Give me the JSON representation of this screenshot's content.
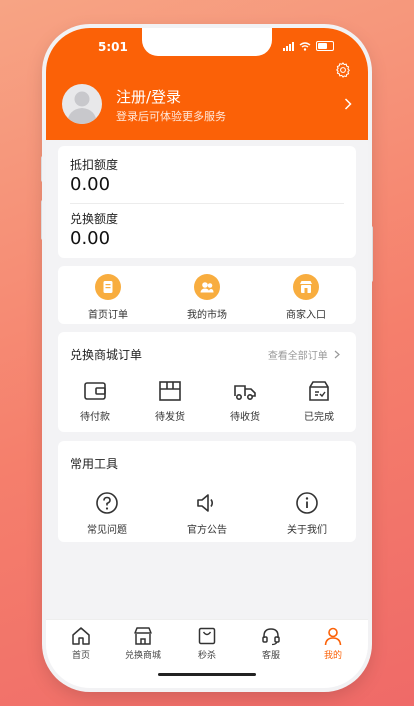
{
  "status_bar": {
    "time": "5:01"
  },
  "header": {
    "login_title": "注册/登录",
    "login_subtitle": "登录后可体验更多服务",
    "accent": "#fb6107"
  },
  "balances": {
    "deduct_label": "抵扣额度",
    "deduct_value": "0.00",
    "exchange_label": "兑换额度",
    "exchange_value": "0.00"
  },
  "quick_links": [
    {
      "label": "首页订单",
      "icon": "document-icon"
    },
    {
      "label": "我的市场",
      "icon": "users-icon"
    },
    {
      "label": "商家入口",
      "icon": "shop-icon"
    }
  ],
  "orders": {
    "title": "兑换商城订单",
    "view_all": "查看全部订单",
    "items": [
      {
        "label": "待付款",
        "icon": "wallet-icon"
      },
      {
        "label": "待发货",
        "icon": "box-icon"
      },
      {
        "label": "待收货",
        "icon": "truck-icon"
      },
      {
        "label": "已完成",
        "icon": "completed-box-icon"
      }
    ]
  },
  "tools": {
    "title": "常用工具",
    "items": [
      {
        "label": "常见问题",
        "icon": "question-icon"
      },
      {
        "label": "官方公告",
        "icon": "speaker-icon"
      },
      {
        "label": "关于我们",
        "icon": "info-icon"
      }
    ]
  },
  "tabbar": {
    "items": [
      {
        "label": "首页",
        "icon": "home-icon",
        "active": false
      },
      {
        "label": "兑换商城",
        "icon": "store-icon",
        "active": false
      },
      {
        "label": "秒杀",
        "icon": "bag-icon",
        "active": false
      },
      {
        "label": "客服",
        "icon": "headset-icon",
        "active": false
      },
      {
        "label": "我的",
        "icon": "person-icon",
        "active": true
      }
    ]
  }
}
